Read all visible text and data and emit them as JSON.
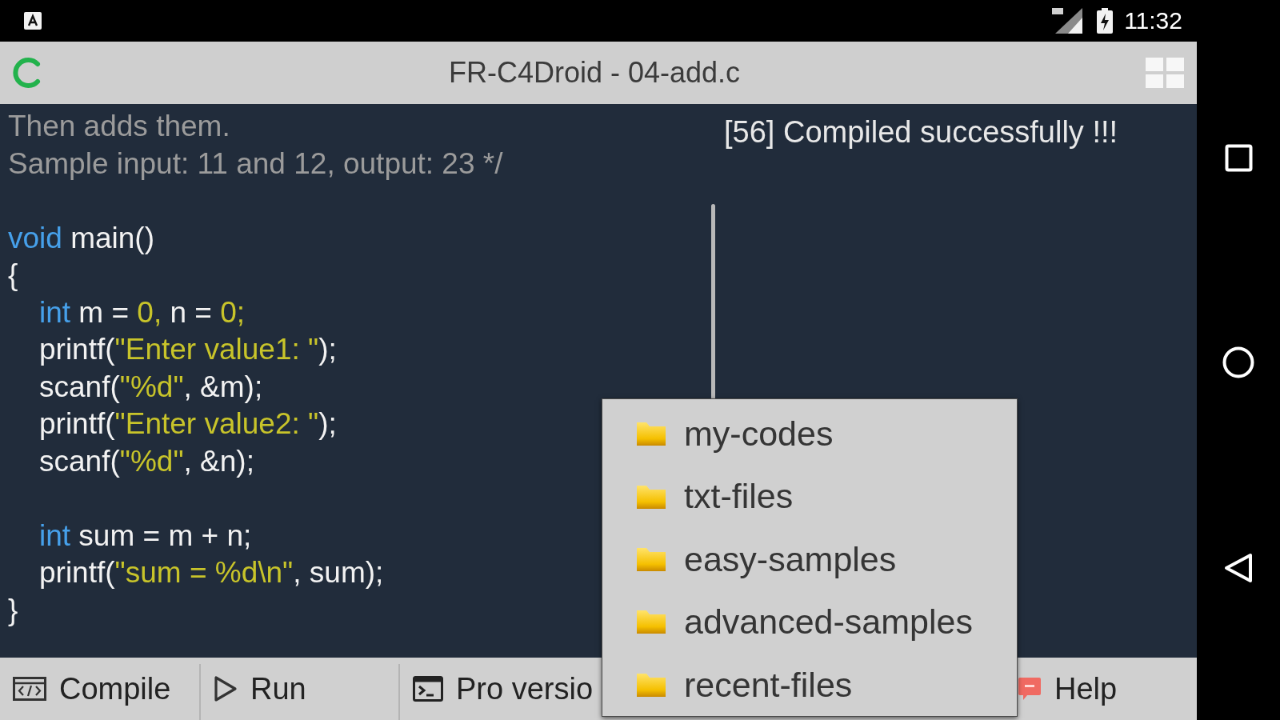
{
  "status_bar": {
    "time": "11:32"
  },
  "title_bar": {
    "title": "FR-C4Droid - 04-add.c"
  },
  "editor": {
    "lines": [
      {
        "kind": "code",
        "segments": [
          {
            "kind": "comment",
            "text": "Then adds them."
          }
        ]
      },
      {
        "kind": "code",
        "segments": [
          {
            "kind": "comment",
            "text": "Sample input: 11 and 12, output: 23 */"
          }
        ]
      },
      {
        "kind": "blank"
      },
      {
        "kind": "code",
        "segments": [
          {
            "kind": "keyword",
            "text": "void"
          },
          {
            "kind": "plain",
            "text": " main()"
          }
        ]
      },
      {
        "kind": "code",
        "segments": [
          {
            "kind": "plain",
            "text": "{"
          }
        ],
        "children": [
          {
            "kind": "code",
            "segments": [
              {
                "kind": "keyword",
                "text": "int"
              },
              {
                "kind": "plain",
                "text": " m = "
              },
              {
                "kind": "literal",
                "text": "0,"
              },
              {
                "kind": "plain",
                "text": " n = "
              },
              {
                "kind": "literal",
                "text": "0;"
              }
            ]
          },
          {
            "kind": "code",
            "segments": [
              {
                "kind": "plain",
                "text": "printf("
              },
              {
                "kind": "literal",
                "text": "\"Enter value1: \""
              },
              {
                "kind": "plain",
                "text": ");"
              }
            ]
          },
          {
            "kind": "code",
            "segments": [
              {
                "kind": "plain",
                "text": "scanf("
              },
              {
                "kind": "literal",
                "text": "\"%d\""
              },
              {
                "kind": "plain",
                "text": ", &m);"
              }
            ]
          },
          {
            "kind": "code",
            "segments": [
              {
                "kind": "plain",
                "text": "printf("
              },
              {
                "kind": "literal",
                "text": "\"Enter value2: \""
              },
              {
                "kind": "plain",
                "text": ");"
              }
            ]
          },
          {
            "kind": "code",
            "segments": [
              {
                "kind": "plain",
                "text": "scanf("
              },
              {
                "kind": "literal",
                "text": "\"%d\""
              },
              {
                "kind": "plain",
                "text": ", &n);"
              }
            ]
          },
          {
            "kind": "blank"
          },
          {
            "kind": "code",
            "segments": [
              {
                "kind": "keyword",
                "text": "int"
              },
              {
                "kind": "plain",
                "text": " sum = m + n;"
              }
            ]
          },
          {
            "kind": "code",
            "segments": [
              {
                "kind": "plain",
                "text": "printf("
              },
              {
                "kind": "literal",
                "text": "\"sum = %d\\n\""
              },
              {
                "kind": "plain",
                "text": ", sum);"
              }
            ]
          }
        ]
      },
      {
        "kind": "code",
        "segments": [
          {
            "kind": "plain",
            "text": "}"
          }
        ]
      }
    ]
  },
  "toast": {
    "text": "[56] Compiled successfully !!!"
  },
  "toolbar": {
    "buttons": [
      {
        "label": "Compile",
        "kind": "compile"
      },
      {
        "label": "Run",
        "kind": "run"
      },
      {
        "label": "Pro versio",
        "kind": "pro"
      },
      {
        "label": "Help",
        "kind": "help"
      }
    ]
  },
  "folder_menu": {
    "items": [
      {
        "label": "my-codes"
      },
      {
        "label": "txt-files"
      },
      {
        "label": "easy-samples"
      },
      {
        "label": "advanced-samples"
      },
      {
        "label": "recent-files"
      }
    ]
  }
}
